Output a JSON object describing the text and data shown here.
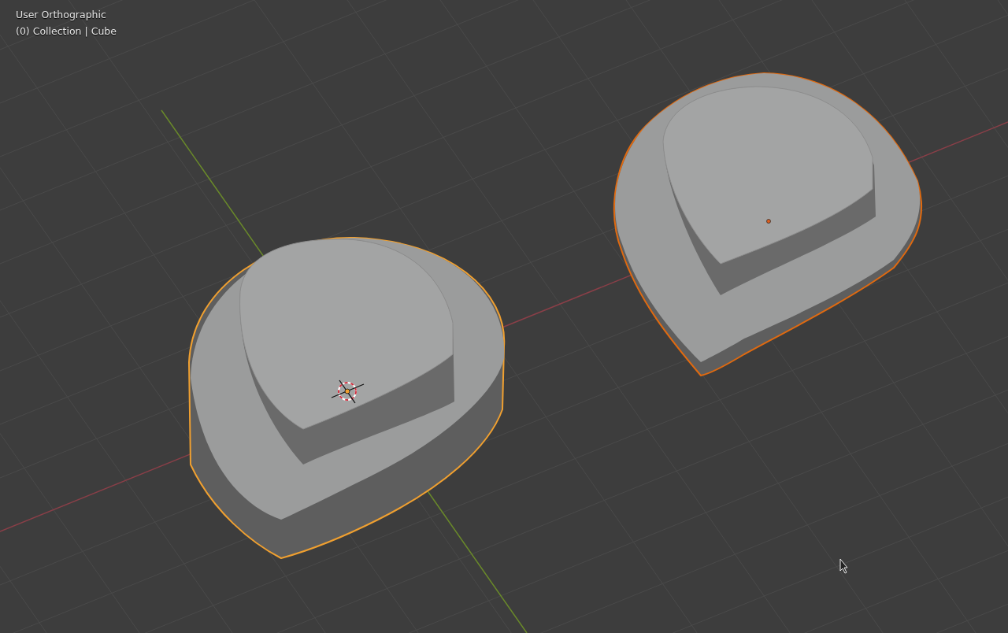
{
  "viewport": {
    "view_name": "User Orthographic",
    "object_info": "(0) Collection | Cube"
  },
  "objects": [
    {
      "color": "#f0a030"
    },
    {
      "color": "#e06a10"
    }
  ]
}
